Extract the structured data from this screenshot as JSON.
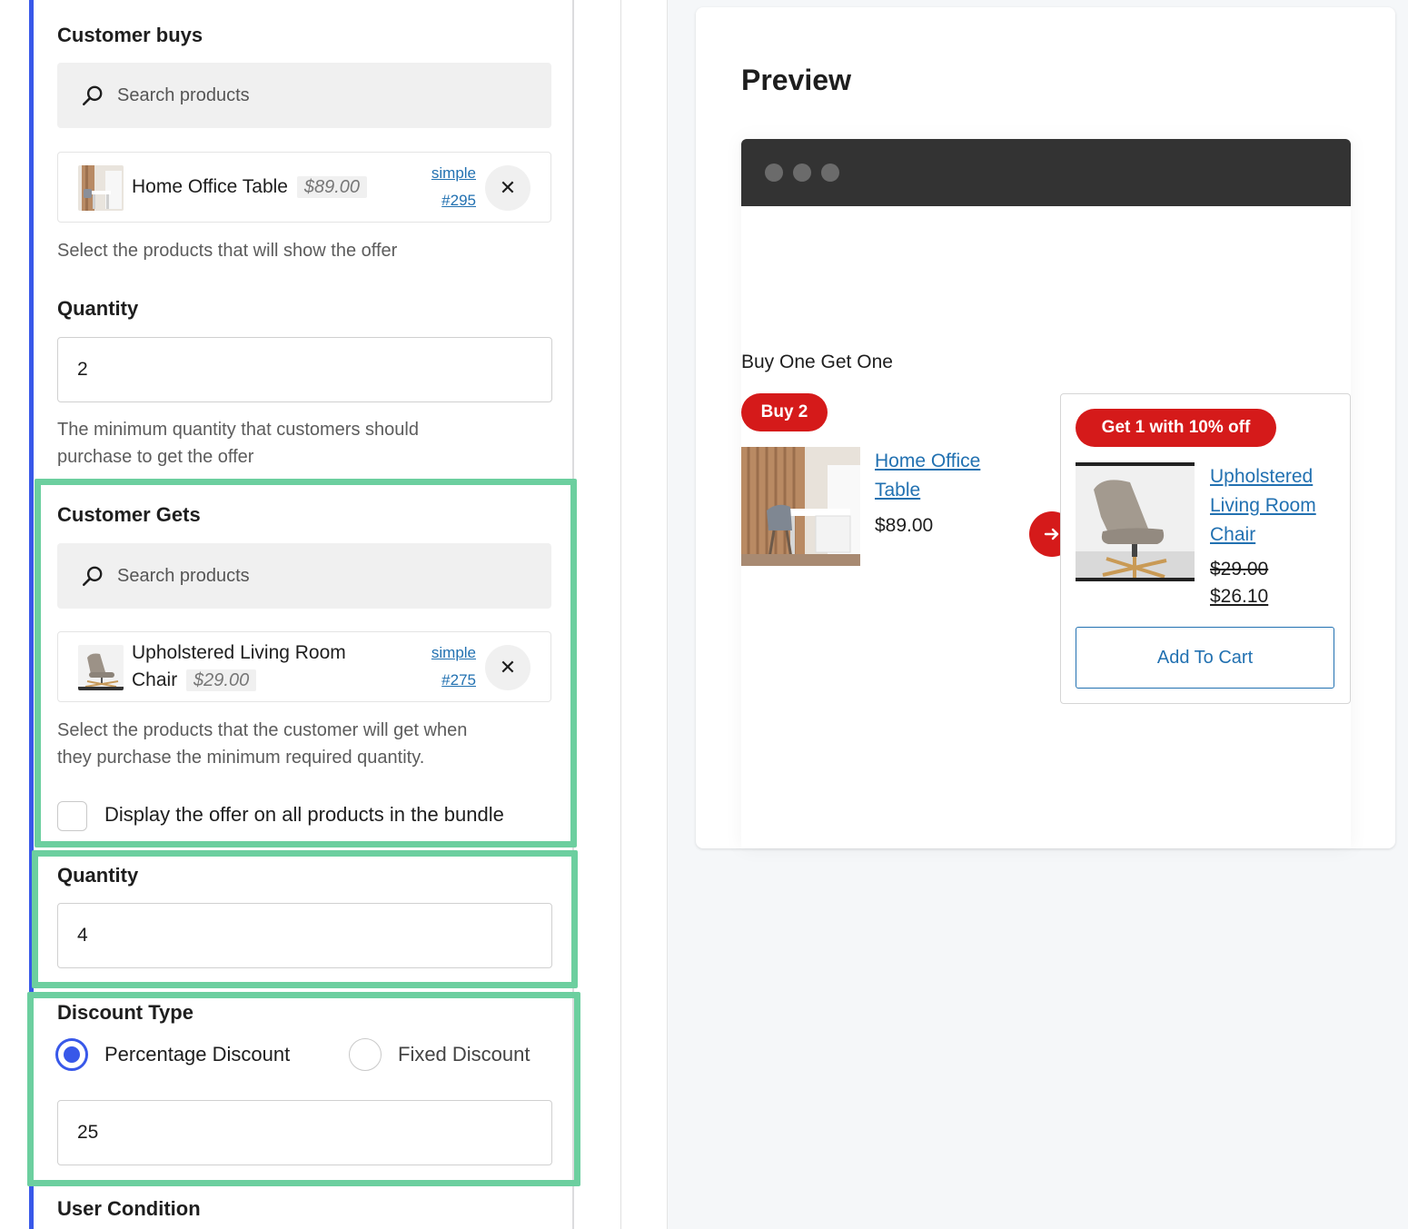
{
  "customer_buys": {
    "heading": "Customer buys",
    "search_placeholder": "Search products",
    "product": {
      "name": "Home Office Table",
      "price": "$89.00",
      "type": "simple",
      "id": "#295"
    },
    "help": "Select the products that will show the offer"
  },
  "buy_quantity": {
    "heading": "Quantity",
    "value": "2",
    "help_line1": "The minimum quantity that customers should",
    "help_line2": "purchase to get the offer"
  },
  "customer_gets": {
    "heading": "Customer Gets",
    "search_placeholder": "Search products",
    "product": {
      "name_line1": "Upholstered Living Room",
      "name_line2": "Chair",
      "price": "$29.00",
      "type": "simple",
      "id": "#275"
    },
    "help_line1": "Select the products that the customer will get when",
    "help_line2": "they purchase the minimum required quantity.",
    "display_all_label": "Display the offer on all products in the bundle"
  },
  "get_quantity": {
    "heading": "Quantity",
    "value": "4"
  },
  "discount": {
    "heading": "Discount Type",
    "option_percentage": "Percentage Discount",
    "option_fixed": "Fixed Discount",
    "selected": "percentage",
    "value": "25"
  },
  "user_condition": {
    "heading": "User Condition"
  },
  "preview": {
    "title": "Preview",
    "offer_title": "Buy One Get One",
    "buy_badge": "Buy 2",
    "buy_product": {
      "name_line1": "Home Office",
      "name_line2": "Table",
      "price": "$89.00"
    },
    "get_badge": "Get 1 with 10% off",
    "get_product": {
      "name_line1": "Upholstered",
      "name_line2": "Living Room",
      "name_line3": "Chair",
      "old_price": "$29.00",
      "new_price": "$26.10"
    },
    "add_to_cart": "Add To Cart"
  },
  "colors": {
    "accent": "#3858e9",
    "highlight": "#6ccf9f",
    "badge": "#d51a1a",
    "link": "#2271b1"
  }
}
